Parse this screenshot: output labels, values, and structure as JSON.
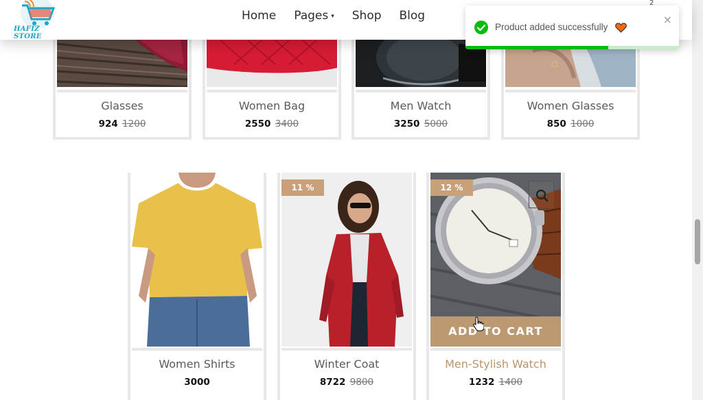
{
  "header": {
    "logo_text": "HAFIZ STORE",
    "nav": [
      {
        "label": "Home"
      },
      {
        "label": "Pages",
        "has_dropdown": true,
        "caret": "▾"
      },
      {
        "label": "Shop"
      },
      {
        "label": "Blog"
      }
    ],
    "cart_count": "2"
  },
  "toast": {
    "message": "Product added successfully",
    "close": "×",
    "progress": 0.67,
    "accent": "#07bc0c",
    "icons": [
      "check-circle-icon",
      "heart-icon"
    ]
  },
  "products_top": [
    {
      "name": "Glasses",
      "price": "924",
      "old_price": "1200"
    },
    {
      "name": "Women Bag",
      "price": "2550",
      "old_price": "3400"
    },
    {
      "name": "Men Watch",
      "price": "3250",
      "old_price": "5000"
    },
    {
      "name": "Women Glasses",
      "price": "850",
      "old_price": "1000"
    }
  ],
  "products_bottom": [
    {
      "name": "Women Shirts",
      "price": "3000",
      "old_price": "",
      "badge": ""
    },
    {
      "name": "Winter Coat",
      "price": "8722",
      "old_price": "9800",
      "badge": "11 %"
    },
    {
      "name": "Men-Stylish Watch",
      "price": "1232",
      "old_price": "1400",
      "badge": "12 %",
      "hovered": true
    }
  ],
  "add_to_cart_label": "ADD TO CART",
  "colors": {
    "accent": "#c8a07a",
    "hover_title": "#b8956a",
    "border": "#e8e8e8"
  }
}
